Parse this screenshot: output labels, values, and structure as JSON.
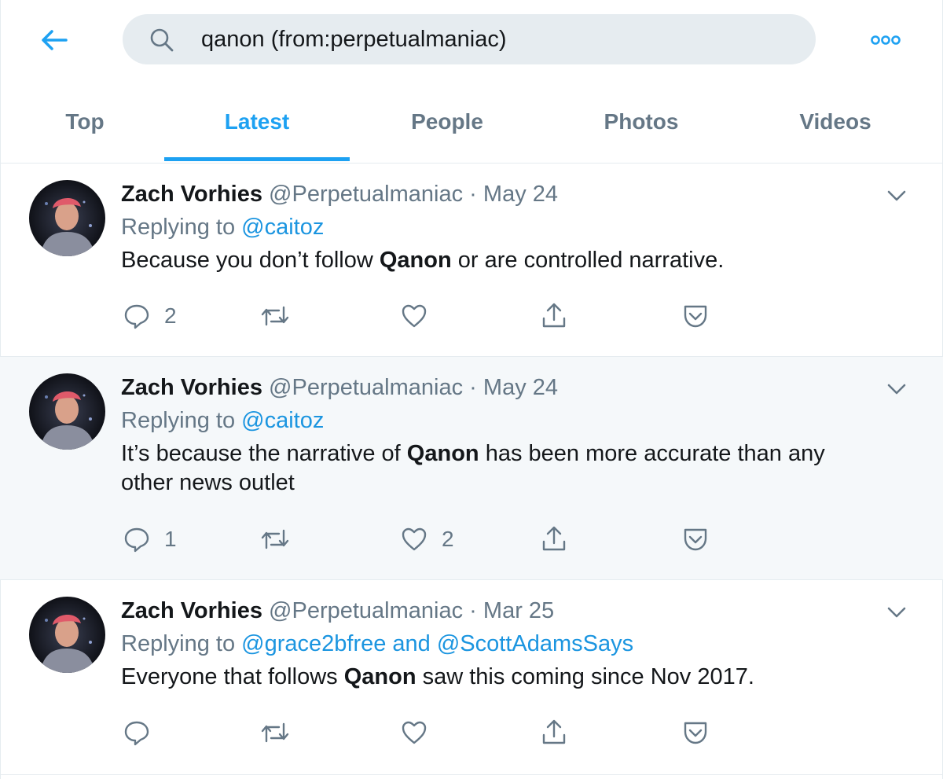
{
  "search": {
    "query": "qanon (from:perpetualmaniac)"
  },
  "tabs": [
    {
      "label": "Top"
    },
    {
      "label": "Latest"
    },
    {
      "label": "People"
    },
    {
      "label": "Photos"
    },
    {
      "label": "Videos"
    }
  ],
  "active_tab": "Latest",
  "colors": {
    "accent": "#1da1f2",
    "link": "#1b95e0",
    "secondary_text": "#657786",
    "highlight_bg": "#f5f8fa"
  },
  "tweets": [
    {
      "name": "Zach Vorhies",
      "handle": "@Perpetualmaniac",
      "dot": "·",
      "date": "May 24",
      "reply_prefix": "Replying to",
      "reply_to": "@caitoz",
      "text_before": "Because you don’t follow ",
      "text_bold": "Qanon",
      "text_after": " or are controlled narrative.",
      "reply_count": "2",
      "like_count": ""
    },
    {
      "name": "Zach Vorhies",
      "handle": "@Perpetualmaniac",
      "dot": "·",
      "date": "May 24",
      "reply_prefix": "Replying to",
      "reply_to": "@caitoz",
      "text_before": "It’s because the narrative of ",
      "text_bold": "Qanon",
      "text_after": " has been more accurate than any other news outlet",
      "reply_count": "1",
      "like_count": "2"
    },
    {
      "name": "Zach Vorhies",
      "handle": "@Perpetualmaniac",
      "dot": "·",
      "date": "Mar 25",
      "reply_prefix": "Replying to",
      "reply_to": "@grace2bfree and @ScottAdamsSays",
      "text_before": "Everyone that follows ",
      "text_bold": "Qanon",
      "text_after": " saw this coming since Nov 2017.",
      "reply_count": "",
      "like_count": ""
    }
  ]
}
